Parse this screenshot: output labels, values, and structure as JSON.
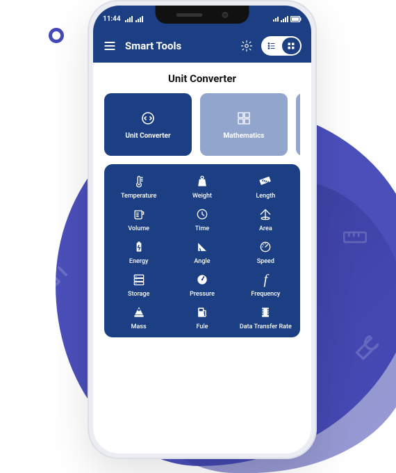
{
  "status": {
    "time": "11:44"
  },
  "appbar": {
    "title": "Smart Tools"
  },
  "section": {
    "title": "Unit Converter"
  },
  "categories": [
    {
      "label": "Unit Converter",
      "active": true
    },
    {
      "label": "Mathematics",
      "active": false
    }
  ],
  "tools": [
    {
      "name": "temperature",
      "label": "Temperature"
    },
    {
      "name": "weight",
      "label": "Weight"
    },
    {
      "name": "length",
      "label": "Length"
    },
    {
      "name": "volume",
      "label": "Volume"
    },
    {
      "name": "time",
      "label": "Time"
    },
    {
      "name": "area",
      "label": "Area"
    },
    {
      "name": "energy",
      "label": "Energy"
    },
    {
      "name": "angle",
      "label": "Angle"
    },
    {
      "name": "speed",
      "label": "Speed"
    },
    {
      "name": "storage",
      "label": "Storage"
    },
    {
      "name": "pressure",
      "label": "Pressure"
    },
    {
      "name": "frequency",
      "label": "Frequency"
    },
    {
      "name": "mass",
      "label": "Mass"
    },
    {
      "name": "fuel",
      "label": "Fule"
    },
    {
      "name": "data-transfer",
      "label": "Data Transfer Rate"
    }
  ],
  "colors": {
    "primary": "#1b3f82",
    "accent": "#4549B8",
    "muted": "#92a5cc"
  }
}
